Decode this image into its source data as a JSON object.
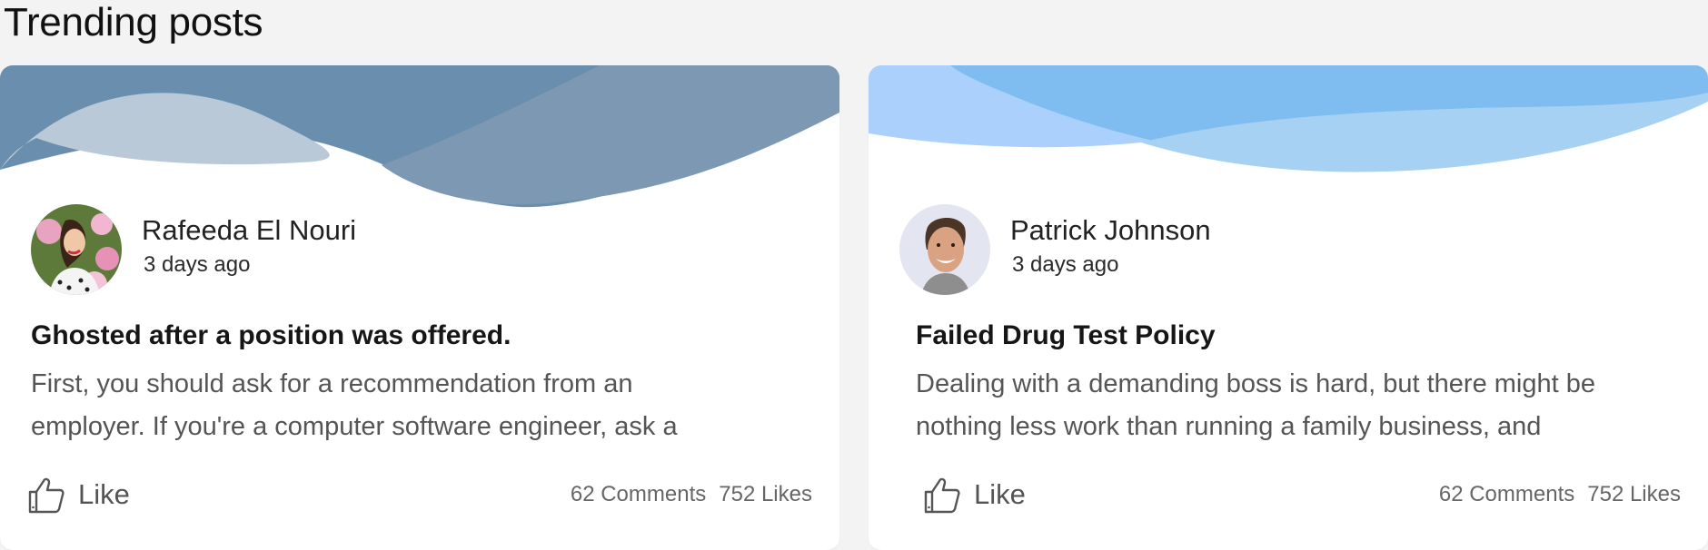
{
  "section": {
    "title": "Trending posts"
  },
  "posts": [
    {
      "author": "Rafeeda El Nouri",
      "time": "3 days ago",
      "title": "Ghosted after a position was offered.",
      "excerpt": "First, you should ask for a recommendation from an\nemployer. If you're a computer software engineer, ask a",
      "like_label": "Like",
      "comments": "62 Comments",
      "likes": "752 Likes",
      "banner_colors": [
        "#5f85a5",
        "#b9c9d7",
        "#7b97b1"
      ],
      "avatar_icon": "woman-with-flowers-avatar"
    },
    {
      "author": "Patrick Johnson",
      "time": "3 days ago",
      "title": "Failed Drug Test Policy",
      "excerpt": "Dealing with a demanding boss is hard, but  there might be\nnothing less work than running a family business, and",
      "like_label": "Like",
      "comments": "62 Comments",
      "likes": "752 Likes",
      "banner_colors": [
        "#a9cdfb",
        "#7dbcf0",
        "#a6d0f1"
      ],
      "avatar_icon": "man-smiling-avatar"
    }
  ]
}
